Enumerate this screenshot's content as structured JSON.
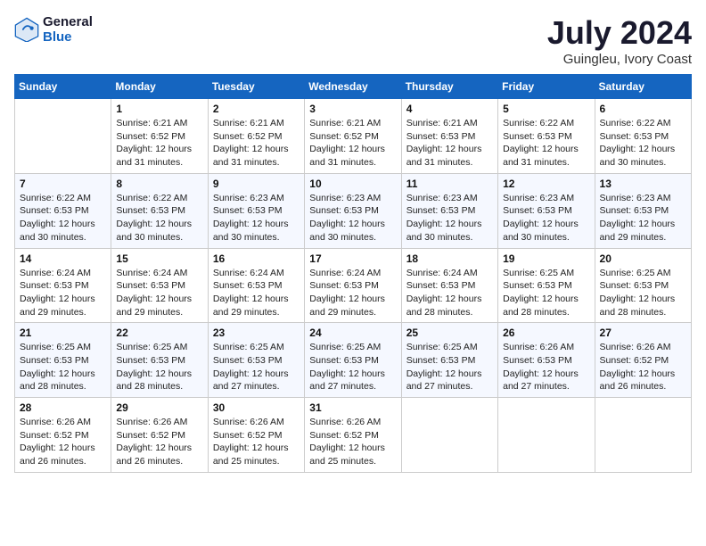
{
  "header": {
    "logo_line1": "General",
    "logo_line2": "Blue",
    "month_title": "July 2024",
    "location": "Guingleu, Ivory Coast"
  },
  "days_of_week": [
    "Sunday",
    "Monday",
    "Tuesday",
    "Wednesday",
    "Thursday",
    "Friday",
    "Saturday"
  ],
  "weeks": [
    [
      {
        "day": "",
        "info": ""
      },
      {
        "day": "1",
        "info": "Sunrise: 6:21 AM\nSunset: 6:52 PM\nDaylight: 12 hours\nand 31 minutes."
      },
      {
        "day": "2",
        "info": "Sunrise: 6:21 AM\nSunset: 6:52 PM\nDaylight: 12 hours\nand 31 minutes."
      },
      {
        "day": "3",
        "info": "Sunrise: 6:21 AM\nSunset: 6:52 PM\nDaylight: 12 hours\nand 31 minutes."
      },
      {
        "day": "4",
        "info": "Sunrise: 6:21 AM\nSunset: 6:53 PM\nDaylight: 12 hours\nand 31 minutes."
      },
      {
        "day": "5",
        "info": "Sunrise: 6:22 AM\nSunset: 6:53 PM\nDaylight: 12 hours\nand 31 minutes."
      },
      {
        "day": "6",
        "info": "Sunrise: 6:22 AM\nSunset: 6:53 PM\nDaylight: 12 hours\nand 30 minutes."
      }
    ],
    [
      {
        "day": "7",
        "info": "Sunrise: 6:22 AM\nSunset: 6:53 PM\nDaylight: 12 hours\nand 30 minutes."
      },
      {
        "day": "8",
        "info": "Sunrise: 6:22 AM\nSunset: 6:53 PM\nDaylight: 12 hours\nand 30 minutes."
      },
      {
        "day": "9",
        "info": "Sunrise: 6:23 AM\nSunset: 6:53 PM\nDaylight: 12 hours\nand 30 minutes."
      },
      {
        "day": "10",
        "info": "Sunrise: 6:23 AM\nSunset: 6:53 PM\nDaylight: 12 hours\nand 30 minutes."
      },
      {
        "day": "11",
        "info": "Sunrise: 6:23 AM\nSunset: 6:53 PM\nDaylight: 12 hours\nand 30 minutes."
      },
      {
        "day": "12",
        "info": "Sunrise: 6:23 AM\nSunset: 6:53 PM\nDaylight: 12 hours\nand 30 minutes."
      },
      {
        "day": "13",
        "info": "Sunrise: 6:23 AM\nSunset: 6:53 PM\nDaylight: 12 hours\nand 29 minutes."
      }
    ],
    [
      {
        "day": "14",
        "info": "Sunrise: 6:24 AM\nSunset: 6:53 PM\nDaylight: 12 hours\nand 29 minutes."
      },
      {
        "day": "15",
        "info": "Sunrise: 6:24 AM\nSunset: 6:53 PM\nDaylight: 12 hours\nand 29 minutes."
      },
      {
        "day": "16",
        "info": "Sunrise: 6:24 AM\nSunset: 6:53 PM\nDaylight: 12 hours\nand 29 minutes."
      },
      {
        "day": "17",
        "info": "Sunrise: 6:24 AM\nSunset: 6:53 PM\nDaylight: 12 hours\nand 29 minutes."
      },
      {
        "day": "18",
        "info": "Sunrise: 6:24 AM\nSunset: 6:53 PM\nDaylight: 12 hours\nand 28 minutes."
      },
      {
        "day": "19",
        "info": "Sunrise: 6:25 AM\nSunset: 6:53 PM\nDaylight: 12 hours\nand 28 minutes."
      },
      {
        "day": "20",
        "info": "Sunrise: 6:25 AM\nSunset: 6:53 PM\nDaylight: 12 hours\nand 28 minutes."
      }
    ],
    [
      {
        "day": "21",
        "info": "Sunrise: 6:25 AM\nSunset: 6:53 PM\nDaylight: 12 hours\nand 28 minutes."
      },
      {
        "day": "22",
        "info": "Sunrise: 6:25 AM\nSunset: 6:53 PM\nDaylight: 12 hours\nand 28 minutes."
      },
      {
        "day": "23",
        "info": "Sunrise: 6:25 AM\nSunset: 6:53 PM\nDaylight: 12 hours\nand 27 minutes."
      },
      {
        "day": "24",
        "info": "Sunrise: 6:25 AM\nSunset: 6:53 PM\nDaylight: 12 hours\nand 27 minutes."
      },
      {
        "day": "25",
        "info": "Sunrise: 6:25 AM\nSunset: 6:53 PM\nDaylight: 12 hours\nand 27 minutes."
      },
      {
        "day": "26",
        "info": "Sunrise: 6:26 AM\nSunset: 6:53 PM\nDaylight: 12 hours\nand 27 minutes."
      },
      {
        "day": "27",
        "info": "Sunrise: 6:26 AM\nSunset: 6:52 PM\nDaylight: 12 hours\nand 26 minutes."
      }
    ],
    [
      {
        "day": "28",
        "info": "Sunrise: 6:26 AM\nSunset: 6:52 PM\nDaylight: 12 hours\nand 26 minutes."
      },
      {
        "day": "29",
        "info": "Sunrise: 6:26 AM\nSunset: 6:52 PM\nDaylight: 12 hours\nand 26 minutes."
      },
      {
        "day": "30",
        "info": "Sunrise: 6:26 AM\nSunset: 6:52 PM\nDaylight: 12 hours\nand 25 minutes."
      },
      {
        "day": "31",
        "info": "Sunrise: 6:26 AM\nSunset: 6:52 PM\nDaylight: 12 hours\nand 25 minutes."
      },
      {
        "day": "",
        "info": ""
      },
      {
        "day": "",
        "info": ""
      },
      {
        "day": "",
        "info": ""
      }
    ]
  ]
}
